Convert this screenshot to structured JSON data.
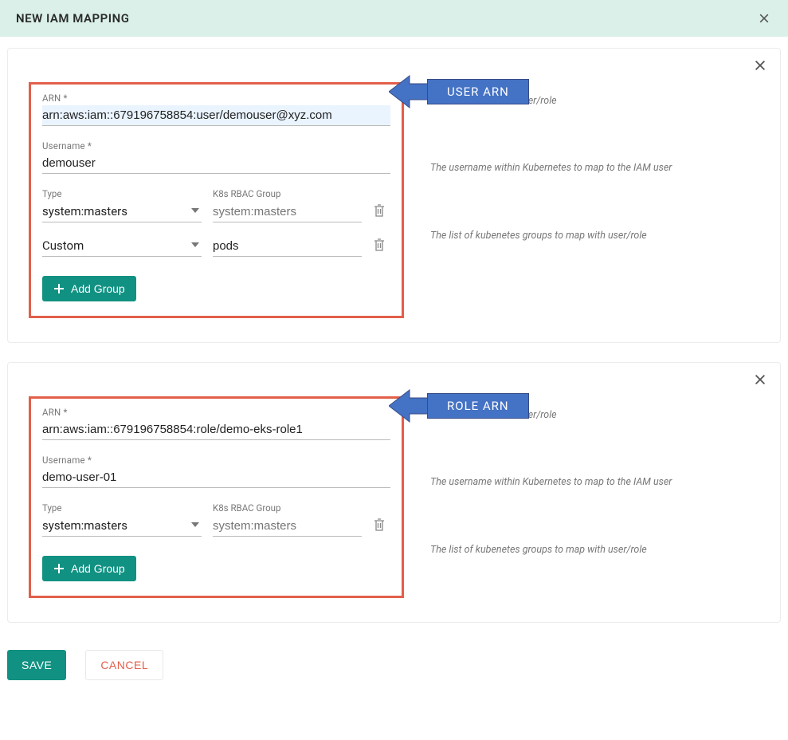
{
  "header": {
    "title": "NEW IAM MAPPING"
  },
  "hints": {
    "arn": "The ARN of the IAM user/role",
    "username": "The username within Kubernetes to map to the IAM user",
    "groups": "The list of kubenetes groups to map with user/role"
  },
  "labels": {
    "arn": "ARN *",
    "username": "Username *",
    "type": "Type",
    "k8sgroup": "K8s RBAC Group",
    "add_group": "Add Group",
    "save": "SAVE",
    "cancel": "CANCEL"
  },
  "callouts": {
    "user": "USER ARN",
    "role": "ROLE ARN"
  },
  "card1": {
    "arn": "arn:aws:iam::679196758854:user/demouser@xyz.com",
    "username": "demouser",
    "groups": [
      {
        "type": "system:masters",
        "name": "",
        "placeholder": "system:masters"
      },
      {
        "type": "Custom",
        "name": "pods",
        "placeholder": ""
      }
    ]
  },
  "card2": {
    "arn": "arn:aws:iam::679196758854:role/demo-eks-role1",
    "username": "demo-user-01",
    "groups": [
      {
        "type": "system:masters",
        "name": "",
        "placeholder": "system:masters"
      }
    ]
  }
}
